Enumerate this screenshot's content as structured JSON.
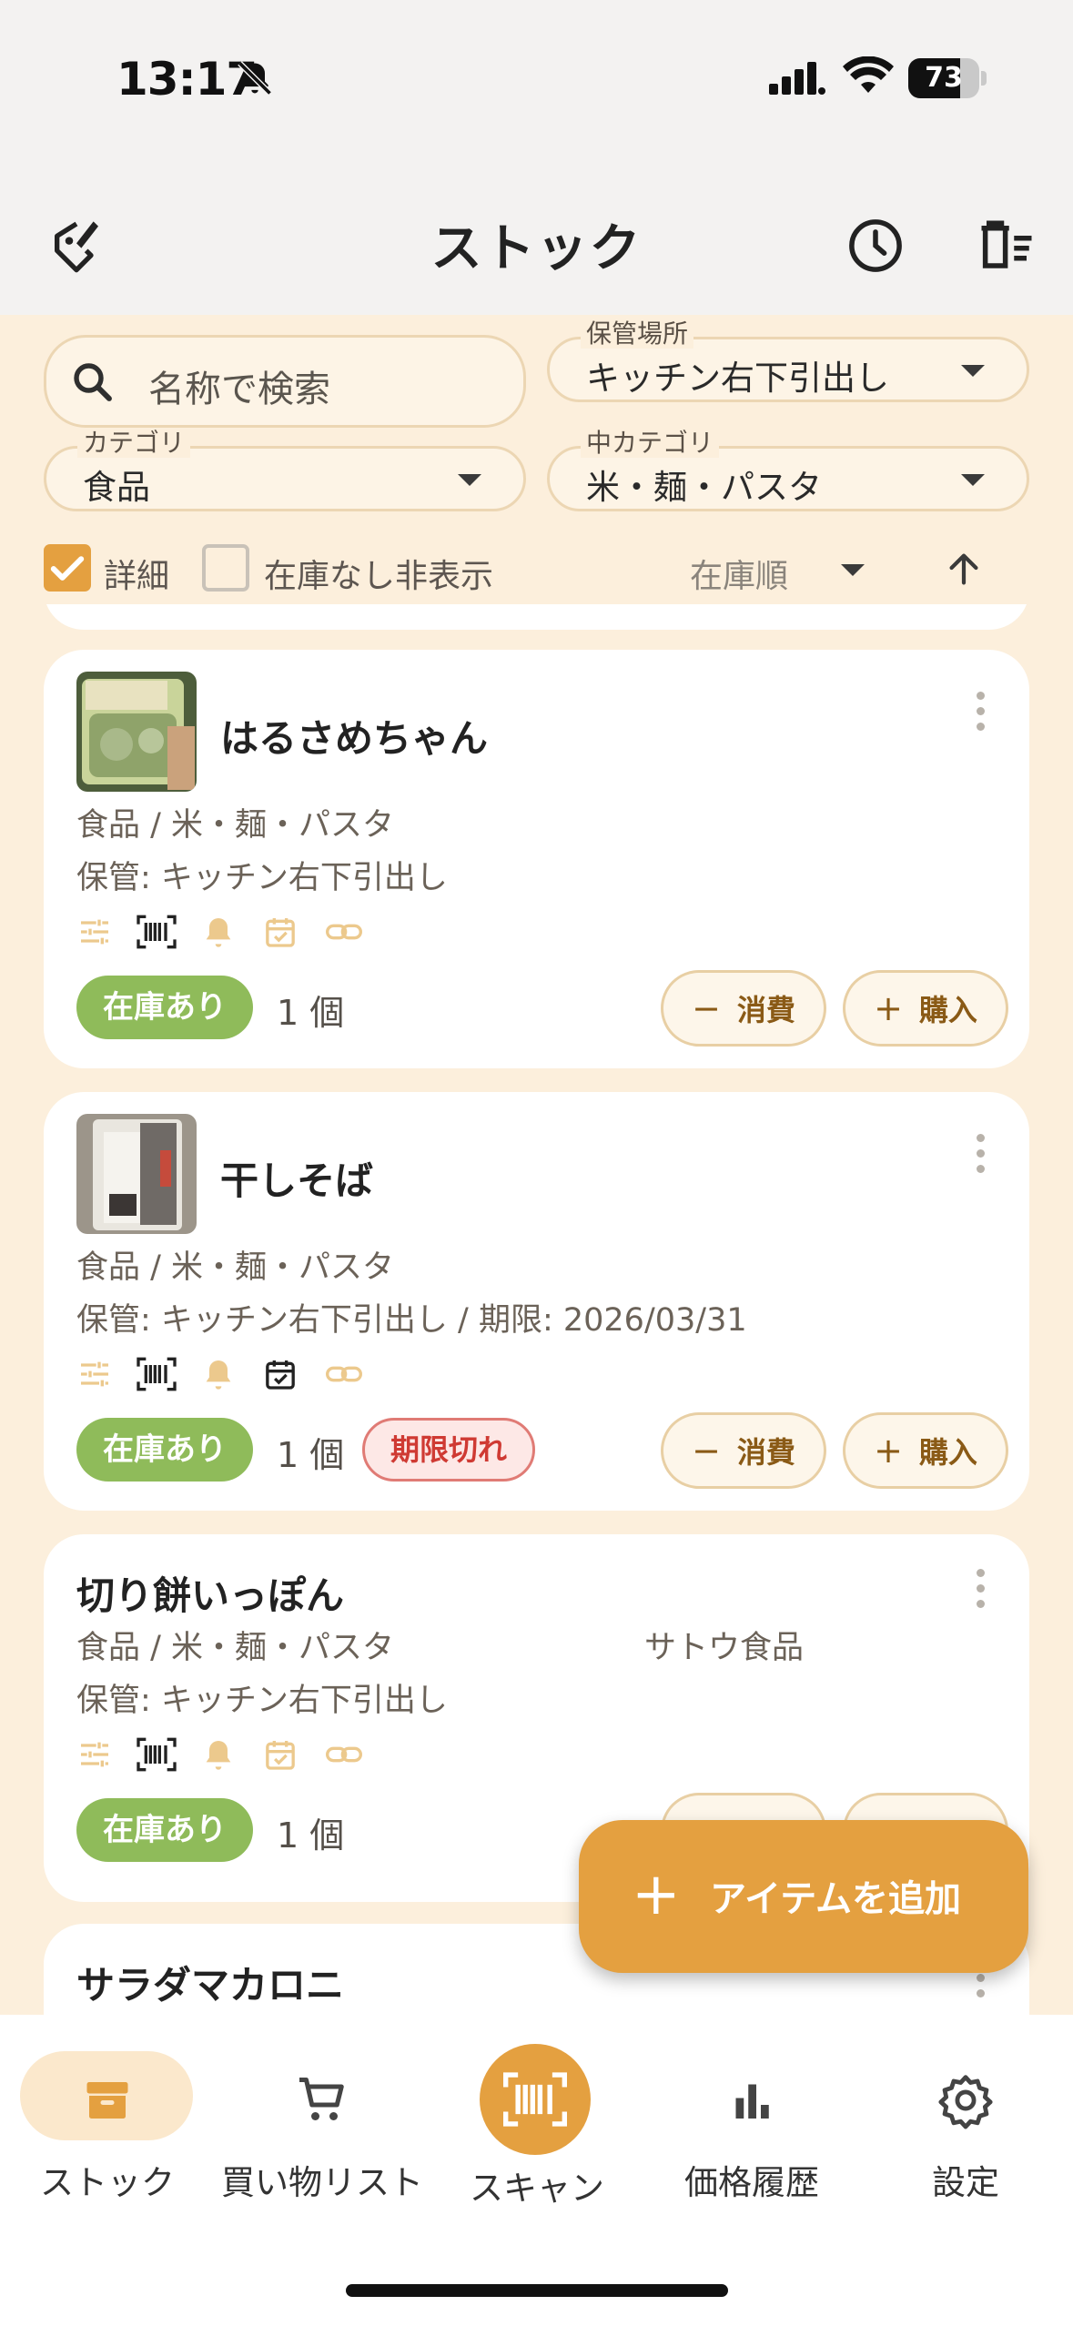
{
  "status": {
    "time": "13:17",
    "battery": "73",
    "battery_level": 0.73
  },
  "header": {
    "title": "ストック"
  },
  "filters": {
    "search_placeholder": "名称で検索",
    "location": {
      "label": "保管場所",
      "value": "キッチン右下引出し"
    },
    "category": {
      "label": "カテゴリ",
      "value": "食品"
    },
    "subcategory": {
      "label": "中カテゴリ",
      "value": "米・麺・パスタ"
    },
    "detail_label": "詳細",
    "detail_checked": true,
    "hide_out_of_stock_label": "在庫なし非表示",
    "hide_out_of_stock_checked": false,
    "sort_label": "在庫順"
  },
  "items": [
    {
      "name": "はるさめちゃん",
      "category_path": "食品 / 米・麺・パスタ",
      "storage": "保管: キッチン右下引出し",
      "stock_status": "在庫あり",
      "quantity": "1 個",
      "consume_label": "消費",
      "buy_label": "購入"
    },
    {
      "name": "干しそば",
      "category_path": "食品 / 米・麺・パスタ",
      "storage": "保管: キッチン右下引出し / 期限: 2026/03/31",
      "stock_status": "在庫あり",
      "quantity": "1 個",
      "expired_label": "期限切れ",
      "consume_label": "消費",
      "buy_label": "購入"
    },
    {
      "name": "切り餅いっぽん",
      "category_path": "食品 / 米・麺・パスタ",
      "maker": "サトウ食品",
      "storage": "保管: キッチン右下引出し",
      "stock_status": "在庫あり",
      "quantity": "1 個"
    },
    {
      "name": "サラダマカロニ"
    }
  ],
  "fab": {
    "label": "アイテムを追加"
  },
  "nav": [
    {
      "label": "ストック",
      "active": true
    },
    {
      "label": "買い物リスト"
    },
    {
      "label": "スキャン"
    },
    {
      "label": "価格履歴"
    },
    {
      "label": "設定"
    }
  ],
  "colors": {
    "accent": "#e4a040",
    "background": "#fcefdc",
    "in_stock": "#8fbb5a",
    "expired": "#cf3a33"
  }
}
